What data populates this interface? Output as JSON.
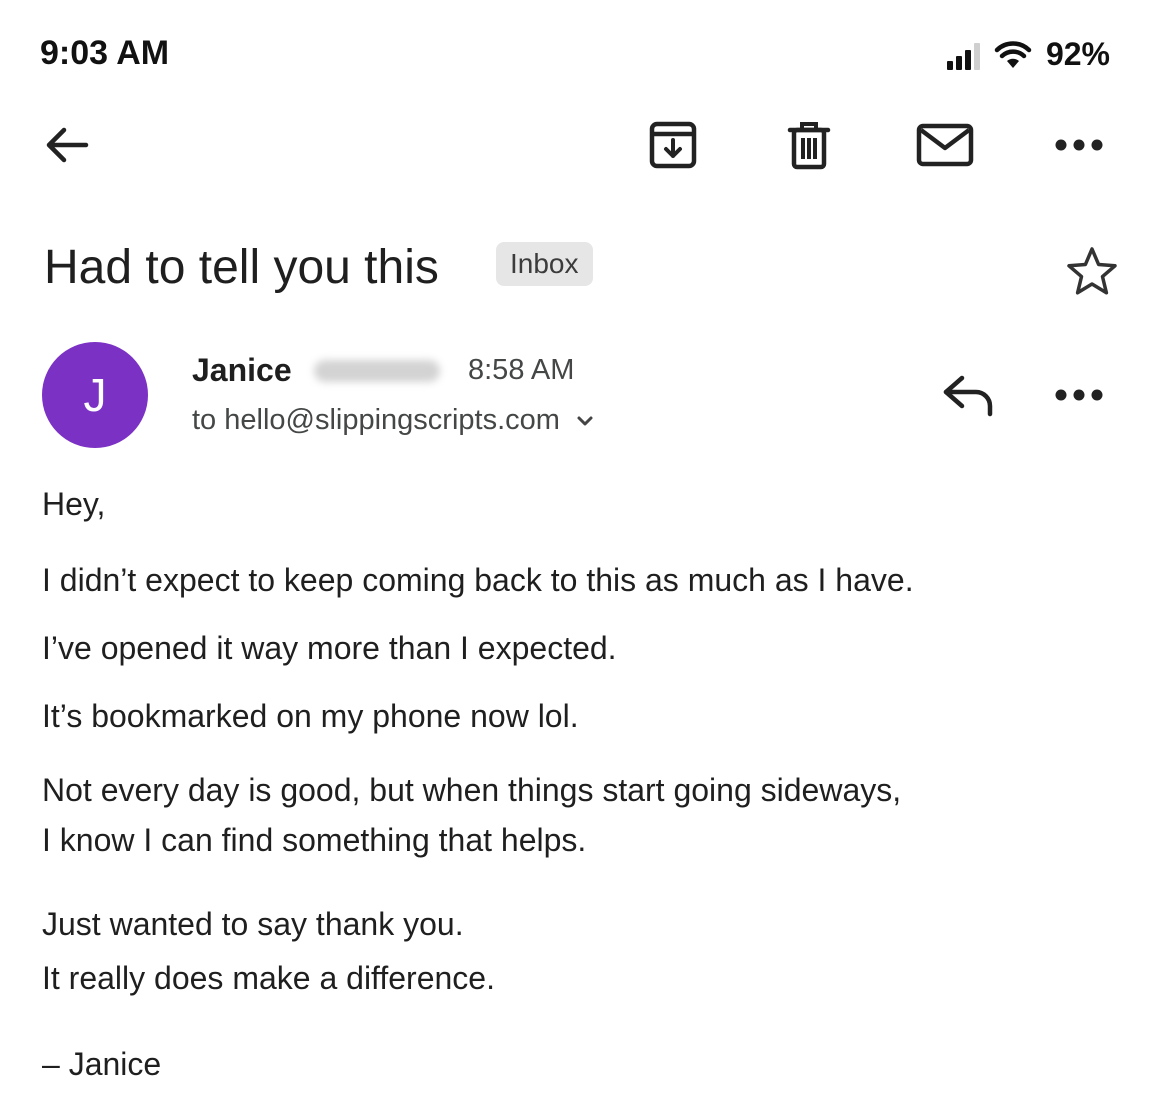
{
  "status_bar": {
    "time": "9:03 AM",
    "battery": "92%",
    "icons": [
      "signal-icon",
      "wifi-icon"
    ]
  },
  "toolbar": {
    "icons": [
      "back-arrow-icon",
      "archive-icon",
      "trash-icon",
      "mail-icon",
      "more-icon"
    ]
  },
  "email": {
    "subject": "Had to tell you this",
    "label": "Inbox",
    "sender_name": "Janice",
    "sender_initial": "J",
    "time": "8:58 AM",
    "recipient": "to hello@slippingscripts.com",
    "body": [
      "Hey,",
      "I didn’t expect to keep coming back to this as much as I have.",
      "I’ve opened it way more than I expected.",
      "It’s bookmarked on my phone now lol.",
      "Not every day is good, but when things start going sideways,",
      "I know I can find something that helps.",
      "Just wanted to say thank you.",
      "It really does make a difference.",
      "– Janice"
    ]
  },
  "colors": {
    "avatar": "#7b31c4",
    "badge_bg": "#e6e6e6",
    "text": "#1f1f1f",
    "secondary_text": "#444746"
  }
}
